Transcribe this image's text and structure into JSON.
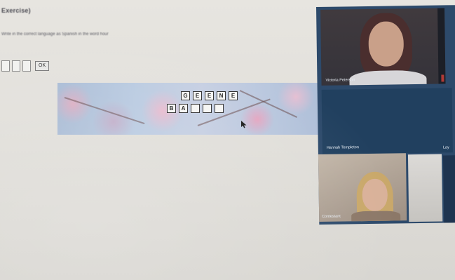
{
  "exercise": {
    "title": "Exercise)",
    "instruction": "Write in the correct language as Spanish in the word hour",
    "ok_label": "OK"
  },
  "puzzle": {
    "row1": [
      "G",
      "E",
      "E",
      "N",
      "E"
    ],
    "row2": [
      "B",
      "A",
      "",
      "",
      ""
    ]
  },
  "video_call": {
    "participant_1_name": "Victoria Peterson",
    "participant_2_name": "Hannah Templeton",
    "participant_3_name": "Contestant",
    "participant_4_name": "Lay"
  }
}
